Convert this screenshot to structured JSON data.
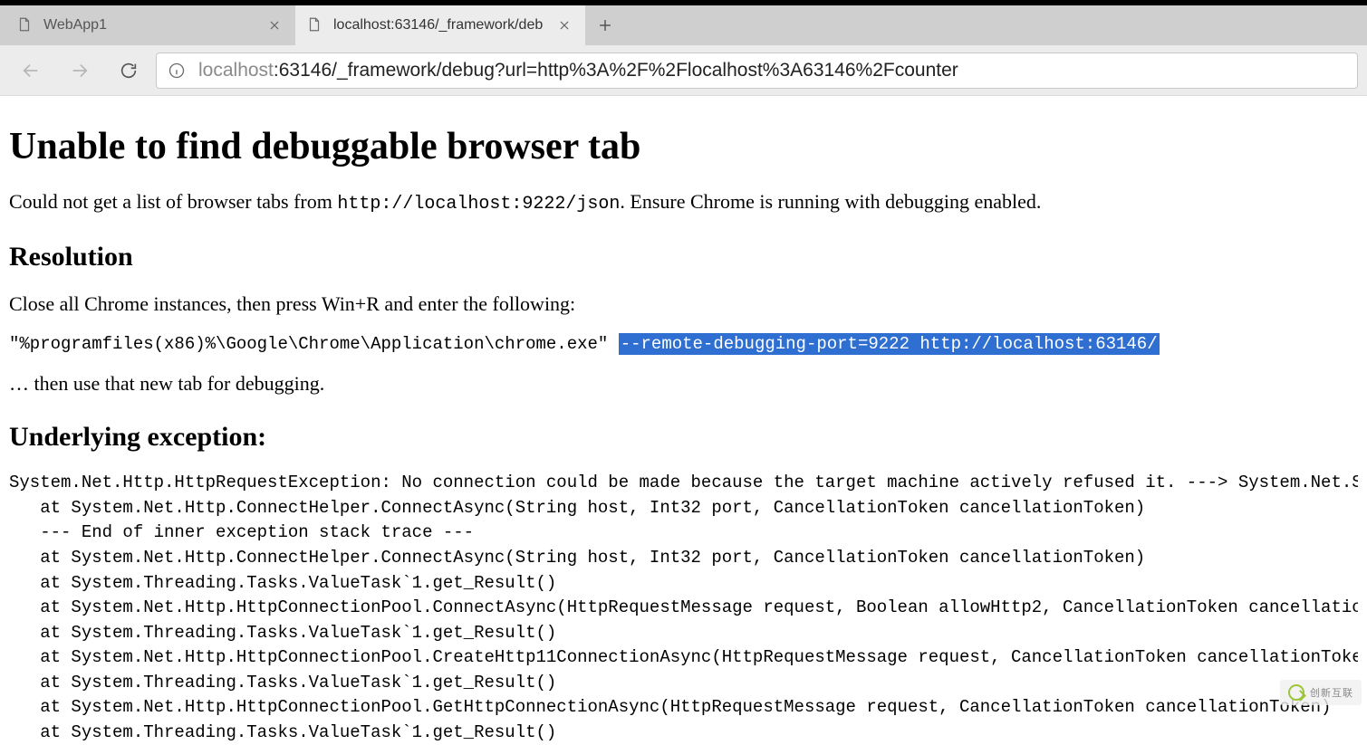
{
  "tabs": [
    {
      "title": "WebApp1",
      "active": false
    },
    {
      "title": "localhost:63146/_framework/deb",
      "active": true
    }
  ],
  "address": {
    "scheme_muted": "localhost",
    "rest": ":63146/_framework/debug?url=http%3A%2F%2Flocalhost%3A63146%2Fcounter"
  },
  "content": {
    "h1": "Unable to find debuggable browser tab",
    "p1_pre": "Could not get a list of browser tabs from ",
    "p1_code": "http://localhost:9222/json",
    "p1_post": ". Ensure Chrome is running with debugging enabled.",
    "h2_resolution": "Resolution",
    "p2": "Close all Chrome instances, then press Win+R and enter the following:",
    "cmd_plain": "\"%programfiles(x86)%\\Google\\Chrome\\Application\\chrome.exe\" ",
    "cmd_selected": "--remote-debugging-port=9222 http://localhost:63146/",
    "p3": "… then use that new tab for debugging.",
    "h2_exception": "Underlying exception:",
    "stack": "System.Net.Http.HttpRequestException: No connection could be made because the target machine actively refused it. ---> System.Net.Sockets.SocketExcep\n   at System.Net.Http.ConnectHelper.ConnectAsync(String host, Int32 port, CancellationToken cancellationToken)\n   --- End of inner exception stack trace ---\n   at System.Net.Http.ConnectHelper.ConnectAsync(String host, Int32 port, CancellationToken cancellationToken)\n   at System.Threading.Tasks.ValueTask`1.get_Result()\n   at System.Net.Http.HttpConnectionPool.ConnectAsync(HttpRequestMessage request, Boolean allowHttp2, CancellationToken cancellationToken)\n   at System.Threading.Tasks.ValueTask`1.get_Result()\n   at System.Net.Http.HttpConnectionPool.CreateHttp11ConnectionAsync(HttpRequestMessage request, CancellationToken cancellationToken)\n   at System.Threading.Tasks.ValueTask`1.get_Result()\n   at System.Net.Http.HttpConnectionPool.GetHttpConnectionAsync(HttpRequestMessage request, CancellationToken cancellationToken)\n   at System.Threading.Tasks.ValueTask`1.get_Result()"
  },
  "watermark": "创新互联"
}
